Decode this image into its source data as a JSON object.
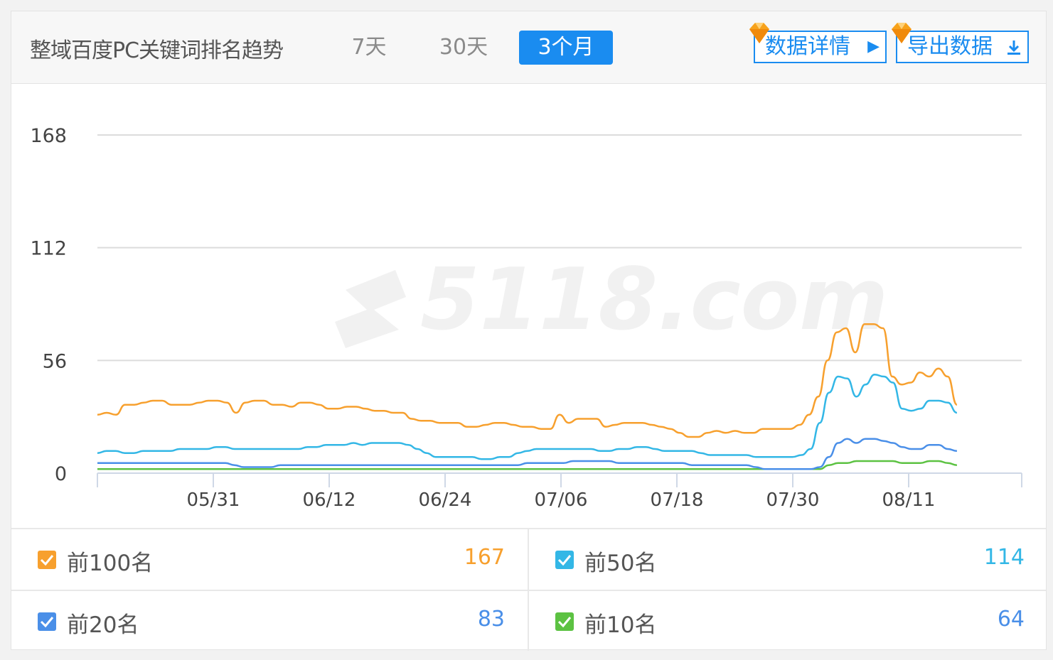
{
  "header": {
    "title": "整域百度PC关键词排名趋势",
    "ranges": [
      "7天",
      "30天",
      "3个月"
    ],
    "active_range": "3个月",
    "details_label": "数据详情",
    "export_label": "导出数据",
    "vip_color": "#f7a21b"
  },
  "chart_data": {
    "type": "line",
    "title": "",
    "xlabel": "",
    "ylabel": "",
    "watermark": "5118.com",
    "x_ticks": [
      "05/31",
      "06/12",
      "06/24",
      "07/06",
      "07/18",
      "07/30",
      "08/11"
    ],
    "y_ticks": [
      0,
      56,
      112,
      168
    ],
    "ylim": [
      0,
      168
    ],
    "x_count": 90,
    "grid": true,
    "legend": "bottom",
    "series": [
      {
        "name": "前100名",
        "color": "#f7a02e",
        "values": [
          29,
          30,
          29,
          34,
          34,
          35,
          36,
          36,
          34,
          34,
          34,
          35,
          36,
          36,
          35,
          30,
          35,
          36,
          36,
          34,
          34,
          33,
          35,
          35,
          34,
          32,
          32,
          33,
          33,
          32,
          31,
          31,
          30,
          30,
          27,
          26,
          26,
          25,
          25,
          25,
          23,
          23,
          24,
          25,
          25,
          24,
          23,
          23,
          22,
          22,
          29,
          25,
          27,
          27,
          27,
          23,
          24,
          25,
          25,
          25,
          24,
          23,
          22,
          20,
          18,
          18,
          20,
          21,
          20,
          21,
          20,
          20,
          22,
          22,
          22,
          22,
          24,
          29,
          38,
          56,
          70,
          72,
          60,
          74,
          74,
          72,
          48,
          44,
          45,
          50,
          48,
          52,
          48,
          34
        ]
      },
      {
        "name": "前50名",
        "color": "#33b7e6",
        "values": [
          10,
          11,
          11,
          10,
          10,
          11,
          11,
          11,
          11,
          12,
          12,
          12,
          12,
          13,
          13,
          12,
          12,
          12,
          12,
          12,
          12,
          12,
          12,
          13,
          13,
          14,
          14,
          14,
          15,
          14,
          15,
          15,
          15,
          15,
          14,
          12,
          10,
          8,
          8,
          8,
          8,
          8,
          7,
          7,
          8,
          8,
          10,
          11,
          12,
          12,
          12,
          12,
          12,
          12,
          12,
          11,
          11,
          12,
          12,
          13,
          13,
          12,
          11,
          11,
          11,
          11,
          10,
          9,
          9,
          9,
          9,
          9,
          8,
          8,
          8,
          8,
          8,
          9,
          12,
          25,
          40,
          48,
          47,
          38,
          44,
          49,
          48,
          45,
          32,
          31,
          32,
          36,
          36,
          35,
          30
        ]
      },
      {
        "name": "前20名",
        "color": "#4a8fe8",
        "values": [
          5,
          5,
          5,
          5,
          5,
          5,
          5,
          5,
          5,
          5,
          5,
          5,
          5,
          5,
          5,
          4,
          3,
          3,
          3,
          3,
          4,
          4,
          4,
          4,
          4,
          4,
          4,
          4,
          4,
          4,
          4,
          4,
          4,
          4,
          4,
          4,
          4,
          4,
          4,
          4,
          4,
          4,
          4,
          4,
          4,
          4,
          4,
          5,
          5,
          5,
          5,
          5,
          6,
          6,
          6,
          6,
          6,
          5,
          5,
          5,
          5,
          5,
          5,
          5,
          5,
          4,
          4,
          4,
          4,
          4,
          4,
          4,
          3,
          2,
          2,
          2,
          2,
          2,
          2,
          3,
          8,
          15,
          17,
          15,
          17,
          17,
          16,
          15,
          13,
          12,
          12,
          14,
          14,
          12,
          11
        ]
      },
      {
        "name": "前10名",
        "color": "#5cc242",
        "values": [
          2,
          2,
          2,
          2,
          2,
          2,
          2,
          2,
          2,
          2,
          2,
          2,
          2,
          2,
          2,
          2,
          2,
          2,
          2,
          2,
          2,
          2,
          2,
          2,
          2,
          2,
          2,
          2,
          2,
          2,
          2,
          2,
          2,
          2,
          2,
          2,
          2,
          2,
          2,
          2,
          2,
          2,
          2,
          2,
          2,
          2,
          2,
          2,
          2,
          2,
          2,
          2,
          2,
          2,
          2,
          2,
          2,
          2,
          2,
          2,
          2,
          2,
          2,
          2,
          2,
          2,
          2,
          2,
          2,
          2,
          2,
          2,
          2,
          2,
          2,
          2,
          2,
          2,
          2,
          2,
          4,
          5,
          5,
          6,
          6,
          6,
          6,
          6,
          5,
          5,
          5,
          6,
          6,
          5,
          4
        ]
      }
    ]
  },
  "legend": [
    {
      "label": "前100名",
      "value": "167",
      "color": "#f7a02e"
    },
    {
      "label": "前50名",
      "value": "114",
      "color": "#33b7e6"
    },
    {
      "label": "前20名",
      "value": "83",
      "color": "#4a8fe8"
    },
    {
      "label": "前10名",
      "value": "64",
      "color": "#5cc242"
    }
  ]
}
